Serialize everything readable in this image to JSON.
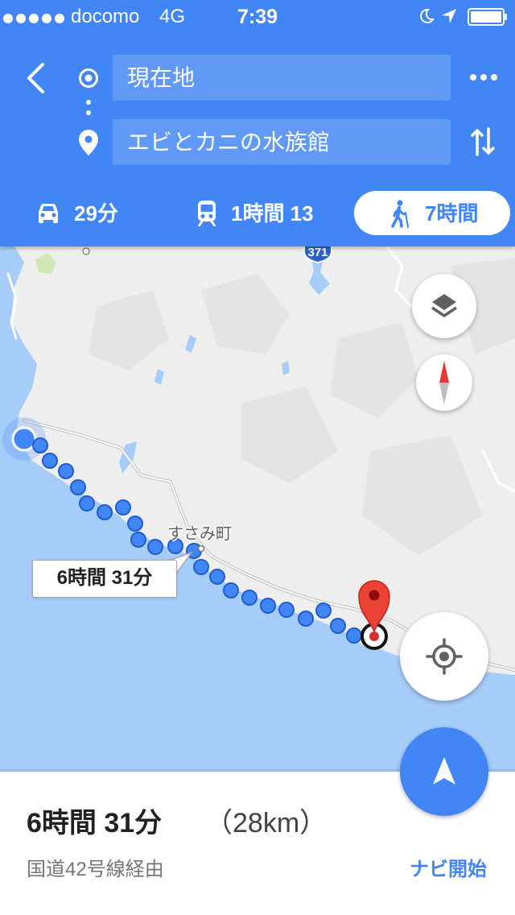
{
  "status_bar": {
    "carrier": "docomo",
    "network": "4G",
    "time": "7:39",
    "signal_bars": 5,
    "battery_level": 1.0,
    "icons": [
      "moon-icon",
      "location-arrow-icon",
      "battery-icon"
    ]
  },
  "header": {
    "back_icon": "chevron-left-icon",
    "origin": {
      "value": "現在地",
      "icon": "origin-circle-icon"
    },
    "destination": {
      "value": "エビとカニの水族館",
      "icon": "place-pin-icon"
    },
    "more_icon": "more-horizontal-icon",
    "swap_icon": "swap-vertical-icon",
    "modes": [
      {
        "icon": "car-icon",
        "label": "29分",
        "selected": false
      },
      {
        "icon": "train-icon",
        "label": "1時間 13",
        "selected": false
      },
      {
        "icon": "walking-icon",
        "label": "7時間",
        "selected": true
      }
    ]
  },
  "map": {
    "road_shield": "371",
    "place_label": "すさみ町",
    "route_callout": "6時間 31分",
    "buttons": [
      "layers-icon",
      "compass-icon",
      "my-location-icon",
      "navigation-arrow-icon"
    ]
  },
  "summary": {
    "duration": "6時間 31分",
    "distance": "（28km）",
    "via": "国道42号線経由",
    "start_button": "ナビ開始"
  },
  "colors": {
    "primary": "#4285f4",
    "route": "#4285f4",
    "water": "#a6ccfa",
    "land": "#eeeeee",
    "destination_pin": "#ea4335",
    "text_primary": "#212121",
    "text_secondary": "#757575"
  }
}
